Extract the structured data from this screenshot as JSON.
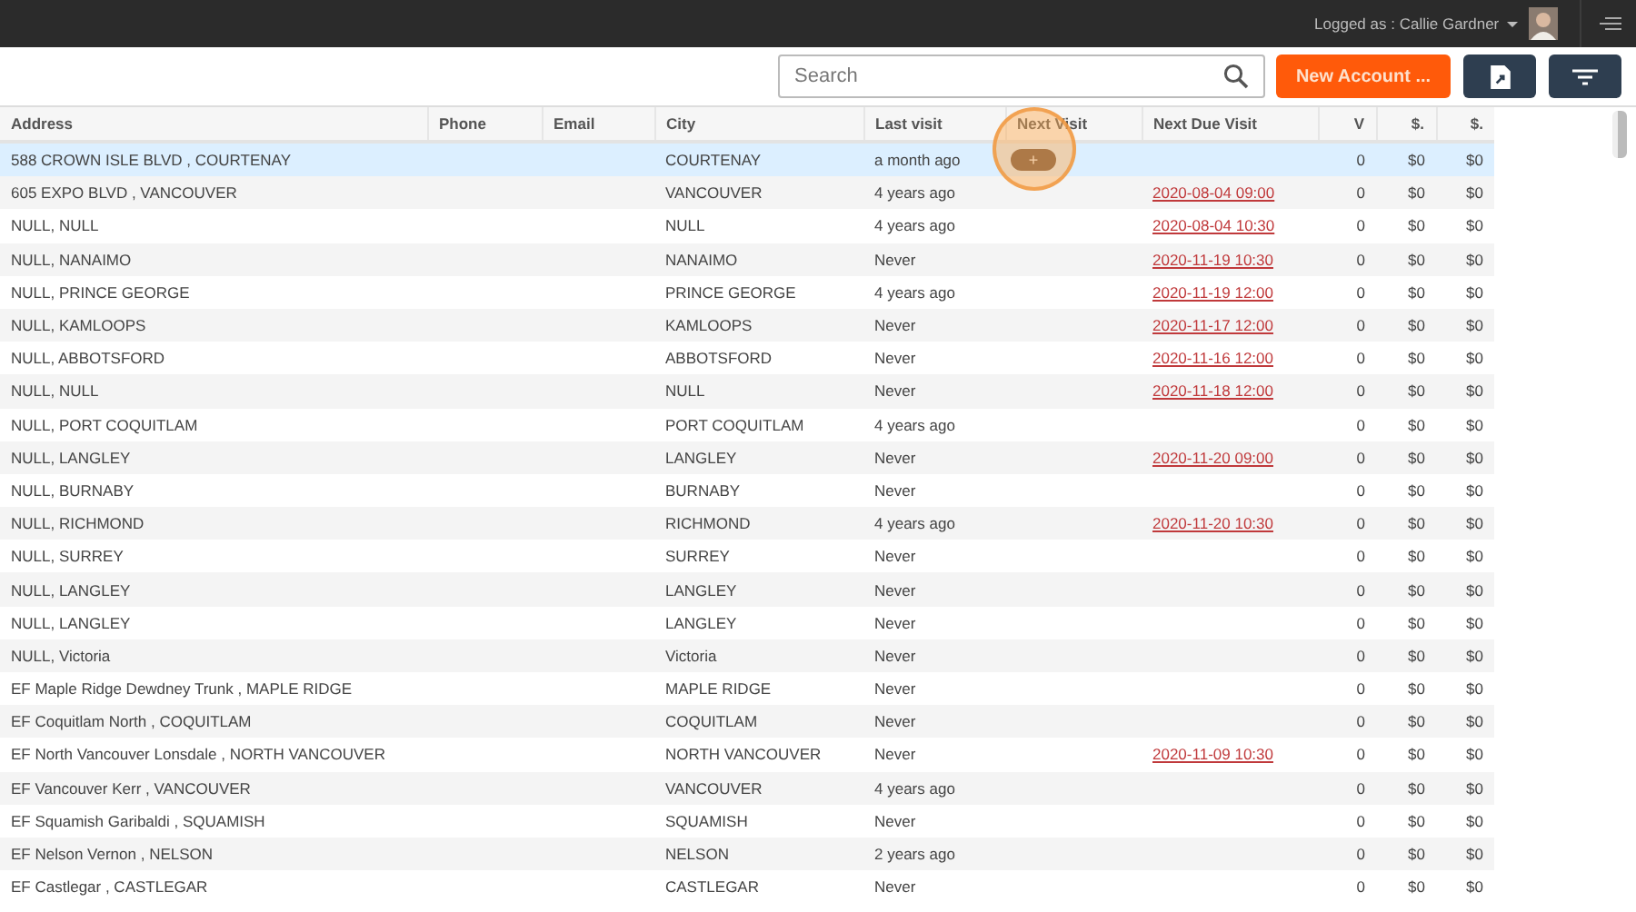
{
  "top_bar": {
    "user_label": "Logged as : Callie Gardner"
  },
  "toolbar": {
    "search": {
      "placeholder": "Search"
    },
    "new_account_button": "New Account ..."
  },
  "table": {
    "columns": [
      "Address",
      "Phone",
      "Email",
      "City",
      "Last visit",
      "Next Visit",
      "Next Due Visit",
      "V",
      "$.",
      "$."
    ],
    "rows": [
      {
        "address": "588 CROWN ISLE BLVD , COURTENAY",
        "city": "COURTENAY",
        "last_visit": "a month ago",
        "add_visit": "+",
        "v": "0",
        "col_8": "$0",
        "col_9": "$0",
        "selected": true
      },
      {
        "address": "605 EXPO BLVD , VANCOUVER",
        "city": "VANCOUVER",
        "last_visit": "4 years ago",
        "next_due": "2020-08-04 09:00",
        "v": "0",
        "col_8": "$0",
        "col_9": "$0",
        "selected": false
      },
      {
        "address": "NULL, NULL",
        "city": "NULL",
        "last_visit": "4 years ago",
        "next_due": "2020-08-04 10:30",
        "v": "0",
        "col_8": "$0",
        "col_9": "$0",
        "selected": false
      },
      {
        "address": "NULL, NANAIMO",
        "city": "NANAIMO",
        "last_visit": "Never",
        "next_due": "2020-11-19 10:30",
        "v": "0",
        "col_8": "$0",
        "col_9": "$0",
        "selected": false
      },
      {
        "address": "NULL, PRINCE GEORGE",
        "city": "PRINCE GEORGE",
        "last_visit": "4 years ago",
        "next_due": "2020-11-19 12:00",
        "v": "0",
        "col_8": "$0",
        "col_9": "$0",
        "selected": false
      },
      {
        "address": "NULL, KAMLOOPS",
        "city": "KAMLOOPS",
        "last_visit": "Never",
        "next_due": "2020-11-17 12:00",
        "v": "0",
        "col_8": "$0",
        "col_9": "$0",
        "selected": false
      },
      {
        "address": "NULL, ABBOTSFORD",
        "city": "ABBOTSFORD",
        "last_visit": "Never",
        "next_due": "2020-11-16 12:00",
        "v": "0",
        "col_8": "$0",
        "col_9": "$0",
        "selected": false
      },
      {
        "address": "NULL, NULL",
        "city": "NULL",
        "last_visit": "Never",
        "next_due": "2020-11-18 12:00",
        "v": "0",
        "col_8": "$0",
        "col_9": "$0",
        "selected": false
      },
      {
        "address": "NULL, PORT COQUITLAM",
        "city": "PORT COQUITLAM",
        "last_visit": "4 years ago",
        "v": "0",
        "col_8": "$0",
        "col_9": "$0",
        "selected": false
      },
      {
        "address": "NULL, LANGLEY",
        "city": "LANGLEY",
        "last_visit": "Never",
        "next_due": "2020-11-20 09:00",
        "v": "0",
        "col_8": "$0",
        "col_9": "$0",
        "selected": false
      },
      {
        "address": "NULL, BURNABY",
        "city": "BURNABY",
        "last_visit": "Never",
        "v": "0",
        "col_8": "$0",
        "col_9": "$0",
        "selected": false
      },
      {
        "address": "NULL, RICHMOND",
        "city": "RICHMOND",
        "last_visit": "4 years ago",
        "next_due": "2020-11-20 10:30",
        "v": "0",
        "col_8": "$0",
        "col_9": "$0",
        "selected": false
      },
      {
        "address": "NULL, SURREY",
        "city": "SURREY",
        "last_visit": "Never",
        "v": "0",
        "col_8": "$0",
        "col_9": "$0",
        "selected": false
      },
      {
        "address": "NULL, LANGLEY",
        "city": "LANGLEY",
        "last_visit": "Never",
        "v": "0",
        "col_8": "$0",
        "col_9": "$0",
        "selected": false
      },
      {
        "address": "NULL, LANGLEY",
        "city": "LANGLEY",
        "last_visit": "Never",
        "v": "0",
        "col_8": "$0",
        "col_9": "$0",
        "selected": false
      },
      {
        "address": "NULL, Victoria",
        "city": "Victoria",
        "last_visit": "Never",
        "v": "0",
        "col_8": "$0",
        "col_9": "$0",
        "selected": false
      },
      {
        "address": "EF Maple Ridge Dewdney Trunk , MAPLE RIDGE",
        "city": "MAPLE RIDGE",
        "last_visit": "Never",
        "v": "0",
        "col_8": "$0",
        "col_9": "$0",
        "selected": false
      },
      {
        "address": "EF Coquitlam North , COQUITLAM",
        "city": "COQUITLAM",
        "last_visit": "Never",
        "v": "0",
        "col_8": "$0",
        "col_9": "$0",
        "selected": false
      },
      {
        "address": "EF North Vancouver Lonsdale , NORTH VANCOUVER",
        "city": "NORTH VANCOUVER",
        "last_visit": "Never",
        "next_due": "2020-11-09 10:30",
        "v": "0",
        "col_8": "$0",
        "col_9": "$0",
        "selected": false
      },
      {
        "address": "EF Vancouver Kerr , VANCOUVER",
        "city": "VANCOUVER",
        "last_visit": "4 years ago",
        "v": "0",
        "col_8": "$0",
        "col_9": "$0",
        "selected": false
      },
      {
        "address": "EF Squamish Garibaldi , SQUAMISH",
        "city": "SQUAMISH",
        "last_visit": "Never",
        "v": "0",
        "col_8": "$0",
        "col_9": "$0",
        "selected": false
      },
      {
        "address": "EF Nelson Vernon , NELSON",
        "city": "NELSON",
        "last_visit": "2 years ago",
        "v": "0",
        "col_8": "$0",
        "col_9": "$0",
        "selected": false
      },
      {
        "address": "EF Castlegar , CASTLEGAR",
        "city": "CASTLEGAR",
        "last_visit": "Never",
        "v": "0",
        "col_8": "$0",
        "col_9": "$0",
        "selected": false
      }
    ]
  }
}
